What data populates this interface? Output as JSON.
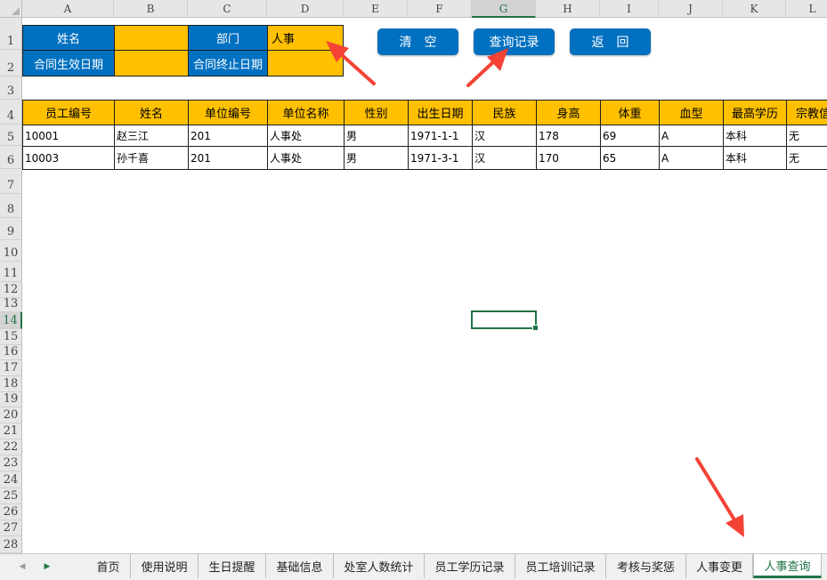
{
  "columns": [
    "A",
    "B",
    "C",
    "D",
    "E",
    "F",
    "G",
    "H",
    "I",
    "J",
    "K",
    "L"
  ],
  "selected_column": "G",
  "rows": [
    "1",
    "2",
    "3",
    "4",
    "5",
    "6",
    "7",
    "8",
    "9",
    "10",
    "11",
    "12",
    "13",
    "14",
    "15",
    "16",
    "17",
    "18",
    "19",
    "20",
    "21",
    "22",
    "23",
    "24",
    "25",
    "26",
    "27",
    "28"
  ],
  "selected_row": "14",
  "query_panel": {
    "name_label": "姓名",
    "name_value": "",
    "dept_label": "部门",
    "dept_value": "人事",
    "contract_start_label": "合同生效日期",
    "contract_start_value": "",
    "contract_end_label": "合同终止日期",
    "contract_end_value": ""
  },
  "buttons": {
    "clear": "清　空",
    "query": "查询记录",
    "back": "返　回"
  },
  "table": {
    "headers": [
      "员工编号",
      "姓名",
      "单位编号",
      "单位名称",
      "性别",
      "出生日期",
      "民族",
      "身高",
      "体重",
      "血型",
      "最高学历",
      "宗教信"
    ],
    "rows": [
      [
        "10001",
        "赵三江",
        "201",
        "人事处",
        "男",
        "1971-1-1",
        "汉",
        "178",
        "69",
        "A",
        "本科",
        "无"
      ],
      [
        "10003",
        "孙千喜",
        "201",
        "人事处",
        "男",
        "1971-3-1",
        "汉",
        "170",
        "65",
        "A",
        "本科",
        "无"
      ]
    ]
  },
  "sheet_tabs": [
    "首页",
    "使用说明",
    "生日提醒",
    "基础信息",
    "处室人数统计",
    "员工学历记录",
    "员工培训记录",
    "考核与奖惩",
    "人事变更",
    "人事查询"
  ],
  "active_tab": "人事查询",
  "colors": {
    "blue": "#0070c0",
    "gold": "#ffc000",
    "excel_green": "#217346",
    "arrow_red": "#f44336"
  },
  "icons": {
    "tab_prev": "triangle-left-icon",
    "tab_next": "triangle-right-icon",
    "select_all": "select-all-triangle-icon"
  }
}
